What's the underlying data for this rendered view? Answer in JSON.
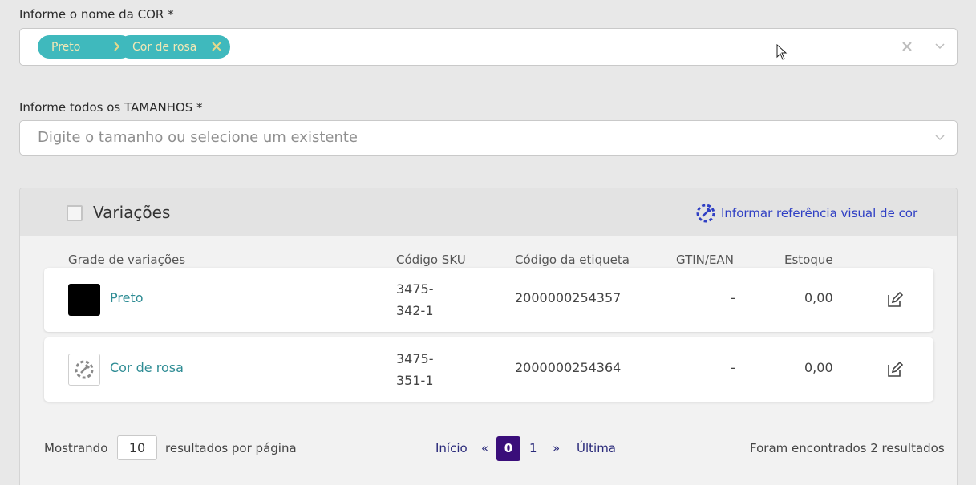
{
  "color_field": {
    "label": "Informe o nome da COR *",
    "chips": [
      {
        "label": "Preto"
      },
      {
        "label": "Cor de rosa"
      }
    ]
  },
  "size_field": {
    "label": "Informe todos os TAMANHOS *",
    "placeholder": "Digite o tamanho ou selecione um existente"
  },
  "variations": {
    "title": "Variações",
    "visual_ref_link": "Informar referência visual de cor",
    "columns": {
      "grade": "Grade de variações",
      "sku": "Código SKU",
      "tag": "Código da etiqueta",
      "gtin": "GTIN/EAN",
      "stock": "Estoque"
    },
    "rows": [
      {
        "name": "Preto",
        "swatch": "#000000",
        "sku": "3475-342-1",
        "sku_l1": "3475-",
        "sku_l2": "342-1",
        "tag": "2000000254357",
        "gtin": "-",
        "stock": "0,00"
      },
      {
        "name": "Cor de rosa",
        "swatch": "picker",
        "sku": "3475-351-1",
        "sku_l1": "3475-",
        "sku_l2": "351-1",
        "tag": "2000000254364",
        "gtin": "-",
        "stock": "0,00"
      }
    ]
  },
  "pagination": {
    "showing": "Mostrando",
    "per_page_value": "10",
    "per_page_suffix": "resultados por página",
    "first": "Início",
    "prev": "«",
    "current": "0",
    "next_page": "1",
    "next": "»",
    "last": "Última",
    "results": "Foram encontrados 2 resultados"
  },
  "colors": {
    "chip": "#3fb9bd",
    "chip_text": "#f3e8b6",
    "link": "#2f3fc4",
    "active_page": "#3a0e7a",
    "row_name": "#2e8c94"
  }
}
